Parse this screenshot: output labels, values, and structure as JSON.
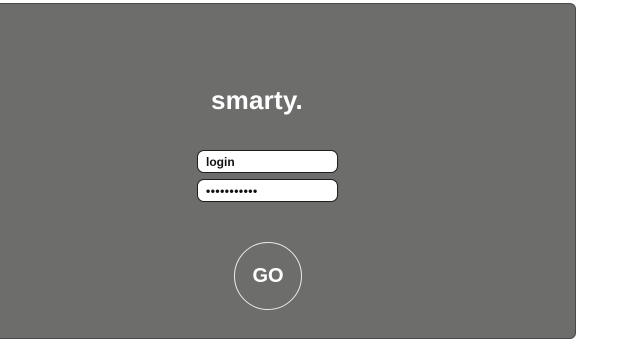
{
  "brand": {
    "logo_text": "smarty."
  },
  "login_form": {
    "login_value": "login",
    "password_value": "•••••••••••",
    "submit_label": "GO"
  },
  "colors": {
    "panel_background": "#6d6d6b",
    "page_background": "#ffffff",
    "text_on_panel": "#ffffff",
    "field_background": "#ffffff",
    "field_border": "#1f1f1f"
  }
}
